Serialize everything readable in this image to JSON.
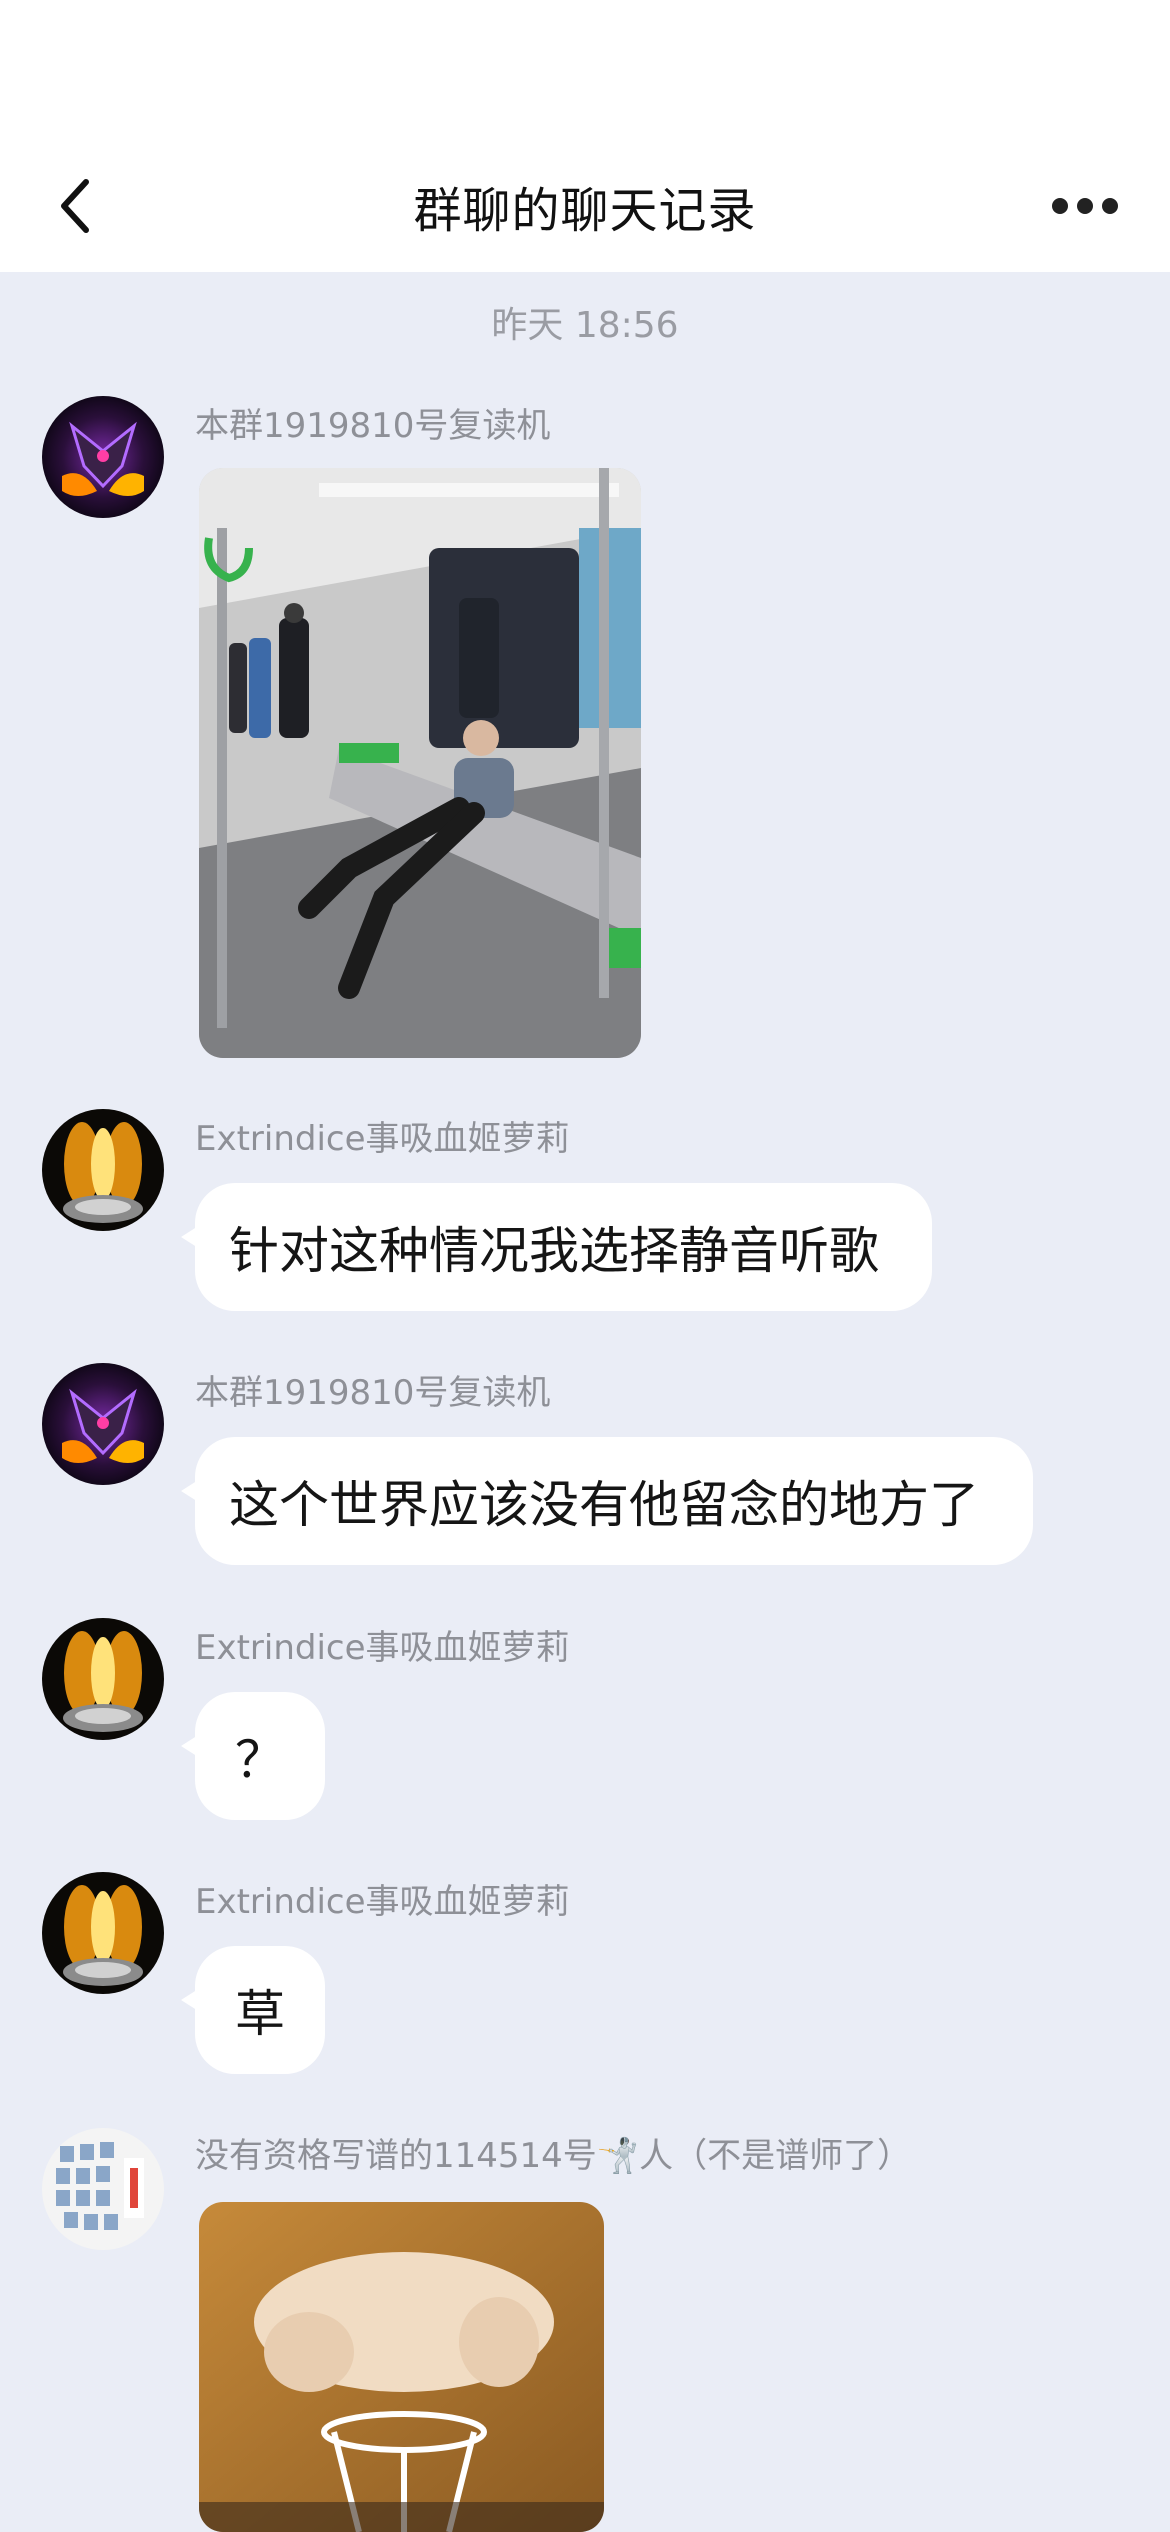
{
  "header": {
    "title": "群聊的聊天记录"
  },
  "timestamp": "昨天 18:56",
  "messages": [
    {
      "sender": "本群1919810号复读机",
      "type": "image",
      "image_desc": "subway-photo"
    },
    {
      "sender": "Extrindice事吸血姬萝莉",
      "type": "text",
      "text": "针对这种情况我选择静音听歌"
    },
    {
      "sender": "本群1919810号复读机",
      "type": "text",
      "text": "这个世界应该没有他留念的地方了"
    },
    {
      "sender": "Extrindice事吸血姬萝莉",
      "type": "text",
      "text": "？"
    },
    {
      "sender": "Extrindice事吸血姬萝莉",
      "type": "text",
      "text": "草"
    },
    {
      "sender": "没有资格写谱的114514号🤺人（不是谱师了）",
      "type": "image",
      "image_desc": "dog-photo"
    }
  ],
  "colors": {
    "background": "#eaedf6",
    "bubble": "#ffffff",
    "sender_text": "#8e9097"
  }
}
